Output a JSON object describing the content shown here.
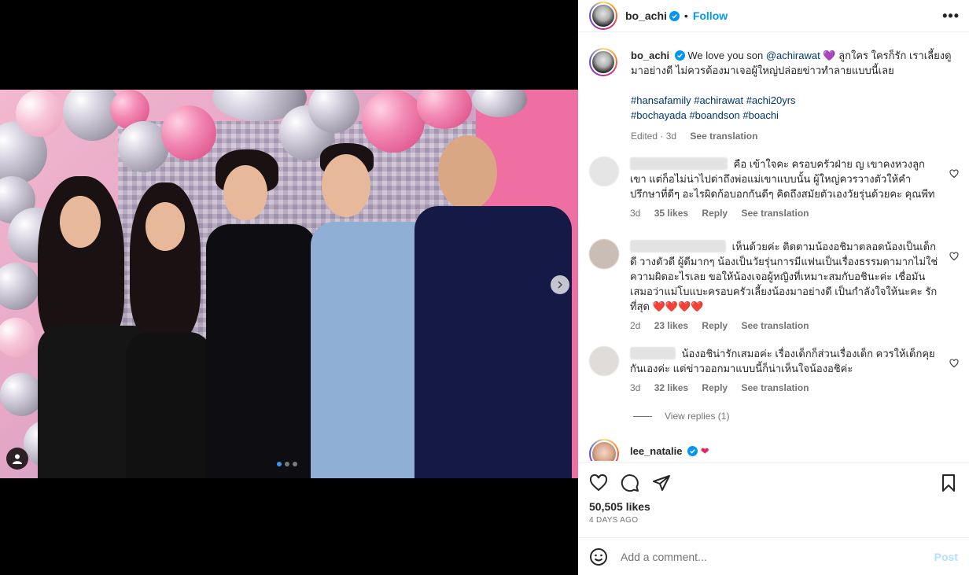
{
  "post": {
    "username": "bo_achi",
    "follow_label": "Follow",
    "separator": "•",
    "more_label": "•••"
  },
  "caption": {
    "username": "bo_achi",
    "text_before_mention": "We love you son ",
    "mention": "@achirawat",
    "heart": "💜",
    "text_after_mention": " ลูกใคร ใครก็รัก เราเลี้ยงดูมาอย่างดี ไม่ควรต้องมาเจอผู้ใหญ่ปล่อยข่าวทำลายแบบนี้เลย",
    "hashtags_line1": "#hansafamily #achirawat #achi20yrs",
    "hashtags_line2": "#bochayada #boandson #boachi",
    "edited": "Edited · 3d",
    "see_translation": "See translation"
  },
  "comments": [
    {
      "text": "คือ เข้าใจคะ ครอบครัวฝ่าย ญ เขาคงหวงลูกเขา แต่ก็อไม่น่าไปด่าถึงพ่อแม่เขาแบบนั้น ผู้ใหญ่ควรวางตัวให้คำปรึกษาที่ดีๆ อะไรผิดก้อบอกกันดีๆ คิดถึงสมัยตัวเองวัยรุ่นด้วยคะ คุณพีท",
      "age": "3d",
      "likes": "35 likes",
      "reply": "Reply",
      "see_translation": "See translation"
    },
    {
      "text": "เห็นด้วยค่ะ ติดตามน้องอชิมาตลอดน้องเป็นเด็กดี วางตัวดี ผู้ดีมากๆ น้องเป็นวัยรุ่นการมีแฟนเป็นเรื่องธรรมดามากไม่ใช่ความผิดอะไรเลย ขอให้น้องเจอผู้หญิงที่เหมาะสมกับอชินะค่ะ เชื่อมันเสมอว่าแม่โบแบะครอบครัวเลี้ยงน้องมาอย่างดี เป็นกำลังใจให้นะคะ รักที่สุด",
      "hearts": "❤️❤️❤️❤️",
      "age": "2d",
      "likes": "23 likes",
      "reply": "Reply",
      "see_translation": "See translation"
    },
    {
      "text": "น้องอชิน่ารักเสมอค่ะ เรื่องเด็กก็ส่วนเรื่องเด็ก ควรให้เด็กคุยกันเองค่ะ แต่ข่าวออกมาแบบนี้ก็น่าเห็นใจน้องอชิค่ะ",
      "age": "3d",
      "likes": "32 likes",
      "reply": "Reply",
      "see_translation": "See translation"
    }
  ],
  "view_replies": "View replies (1)",
  "next_commenter": "lee_natalie",
  "likes": "50,505 likes",
  "timestamp": "4 DAYS AGO",
  "add_comment": {
    "placeholder": "Add a comment...",
    "post_label": "Post"
  },
  "colors": {
    "accent": "#0095f6",
    "muted": "#737373",
    "link": "#00376b"
  }
}
